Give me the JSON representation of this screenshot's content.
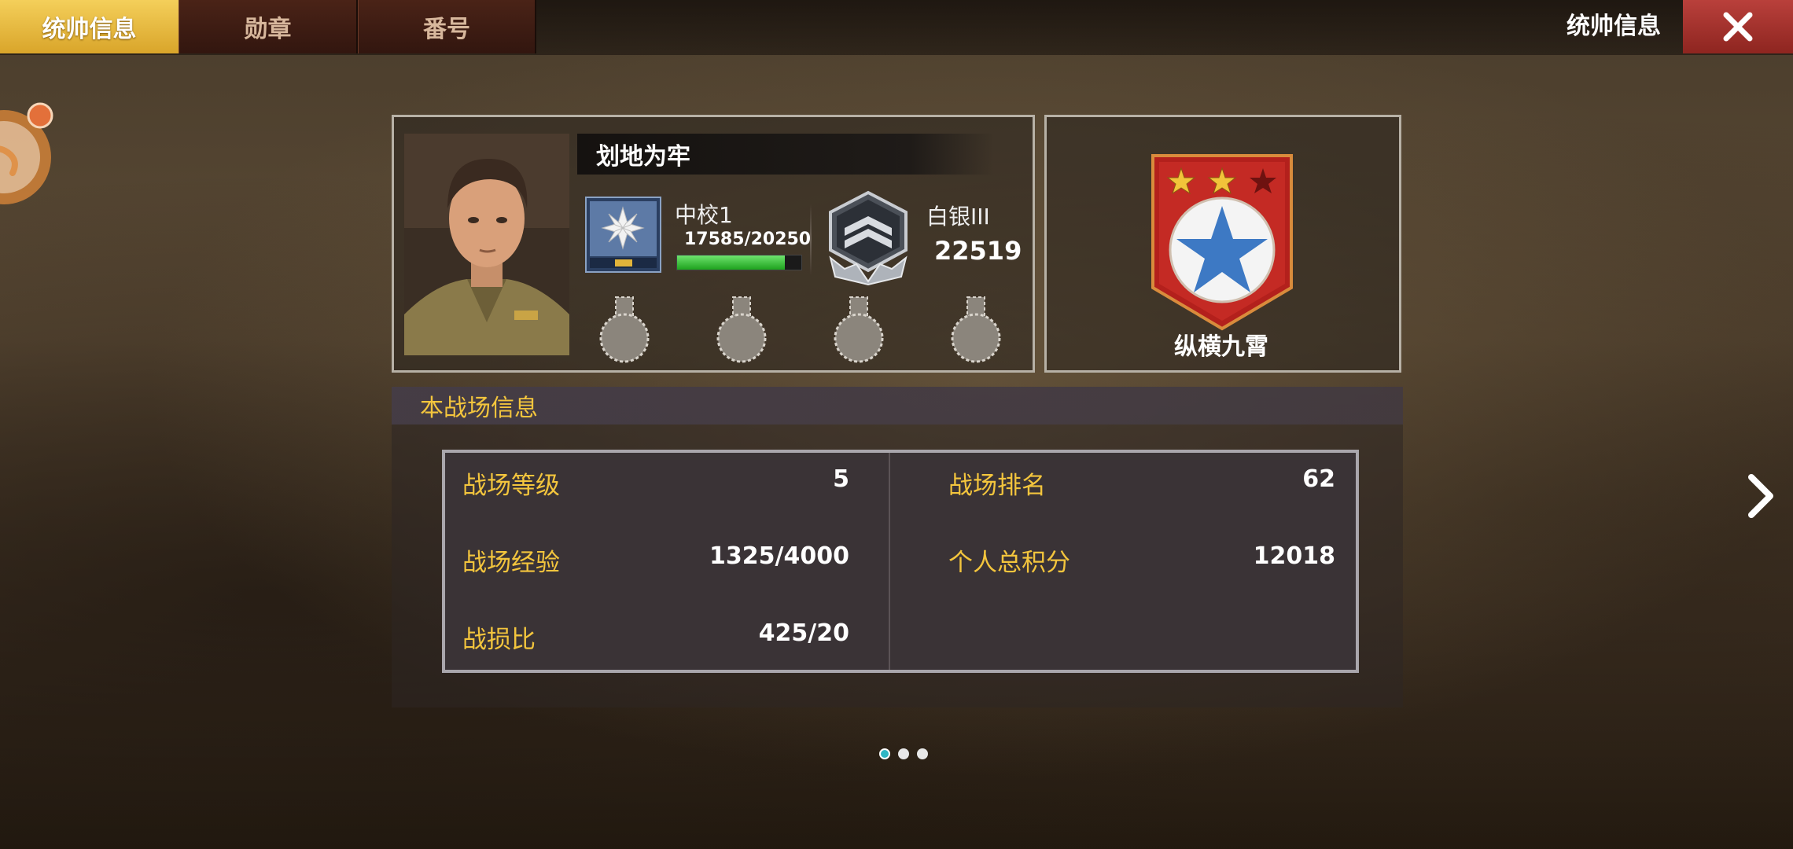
{
  "tabs": [
    {
      "label": "统帅信息",
      "active": true
    },
    {
      "label": "勋章",
      "active": false
    },
    {
      "label": "番号",
      "active": false
    }
  ],
  "header": {
    "title": "统帅信息"
  },
  "commander": {
    "name": "划地为牢",
    "rank": "中校1",
    "exp_text": "17585/20250",
    "exp_fraction": 0.868,
    "tier": "白银III",
    "tier_score": "22519"
  },
  "emblem": {
    "label": "纵横九霄",
    "stars_filled": 2,
    "stars_total": 3
  },
  "battlefield": {
    "title": "本战场信息",
    "left": [
      {
        "label": "战场等级",
        "value": "5"
      },
      {
        "label": "战场经验",
        "value": "1325/4000"
      },
      {
        "label": "战损比",
        "value": "425/20"
      }
    ],
    "right": [
      {
        "label": "战场排名",
        "value": "62"
      },
      {
        "label": "个人总积分",
        "value": "12018"
      }
    ]
  },
  "pager": {
    "total": 3,
    "current": 1
  },
  "colors": {
    "accent_gold": "#f3c53d",
    "exp_green": "#1ea21e",
    "close_red": "#b9403b"
  }
}
